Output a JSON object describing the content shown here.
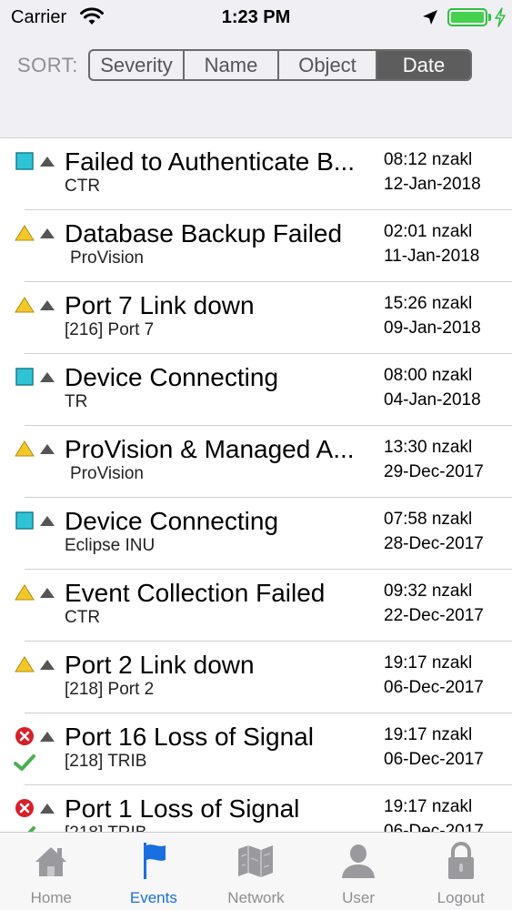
{
  "status_bar": {
    "carrier": "Carrier",
    "time": "1:23 PM"
  },
  "sort": {
    "label": "SORT:",
    "options": [
      "Severity",
      "Name",
      "Object",
      "Date"
    ],
    "selected": "Date"
  },
  "events": [
    {
      "severity": "info",
      "title": "Failed to Authenticate B...",
      "subtitle": "CTR",
      "time": "08:12 nzakl",
      "date": "12-Jan-2018",
      "acknowledged": false
    },
    {
      "severity": "warning",
      "title": "Database Backup Failed",
      "subtitle": "ProVision",
      "time": "02:01 nzakl",
      "date": "11-Jan-2018",
      "acknowledged": false
    },
    {
      "severity": "warning",
      "title": "Port 7 Link down",
      "subtitle": "[216] Port 7",
      "time": "15:26 nzakl",
      "date": "09-Jan-2018",
      "acknowledged": false
    },
    {
      "severity": "info",
      "title": "Device Connecting",
      "subtitle": "TR",
      "time": "08:00 nzakl",
      "date": "04-Jan-2018",
      "acknowledged": false
    },
    {
      "severity": "warning",
      "title": "ProVision & Managed A...",
      "subtitle": "ProVision",
      "time": "13:30 nzakl",
      "date": "29-Dec-2017",
      "acknowledged": false
    },
    {
      "severity": "info",
      "title": "Device Connecting",
      "subtitle": "Eclipse INU",
      "time": "07:58 nzakl",
      "date": "28-Dec-2017",
      "acknowledged": false
    },
    {
      "severity": "warning",
      "title": "Event Collection Failed",
      "subtitle": "CTR",
      "time": "09:32 nzakl",
      "date": "22-Dec-2017",
      "acknowledged": false
    },
    {
      "severity": "warning",
      "title": "Port 2 Link down",
      "subtitle": "[218] Port 2",
      "time": "19:17 nzakl",
      "date": "06-Dec-2017",
      "acknowledged": false
    },
    {
      "severity": "critical",
      "title": "Port 16 Loss of Signal",
      "subtitle": "[218] TRIB",
      "time": "19:17 nzakl",
      "date": "06-Dec-2017",
      "acknowledged": true
    },
    {
      "severity": "critical",
      "title": "Port 1 Loss of Signal",
      "subtitle": "[218] TRIB",
      "time": "19:17 nzakl",
      "date": "06-Dec-2017",
      "acknowledged": true
    }
  ],
  "tabs": [
    {
      "label": "Home",
      "icon": "home-icon"
    },
    {
      "label": "Events",
      "icon": "flag-icon"
    },
    {
      "label": "Network",
      "icon": "map-icon"
    },
    {
      "label": "User",
      "icon": "user-icon"
    },
    {
      "label": "Logout",
      "icon": "lock-icon"
    }
  ],
  "active_tab": "Events",
  "colors": {
    "info": "#2ec4d6",
    "warning": "#f2c72a",
    "critical": "#d6202a",
    "acknowledged": "#4caf50",
    "active_tab": "#1a6fe0",
    "segment_selected": "#5d5d5d"
  }
}
